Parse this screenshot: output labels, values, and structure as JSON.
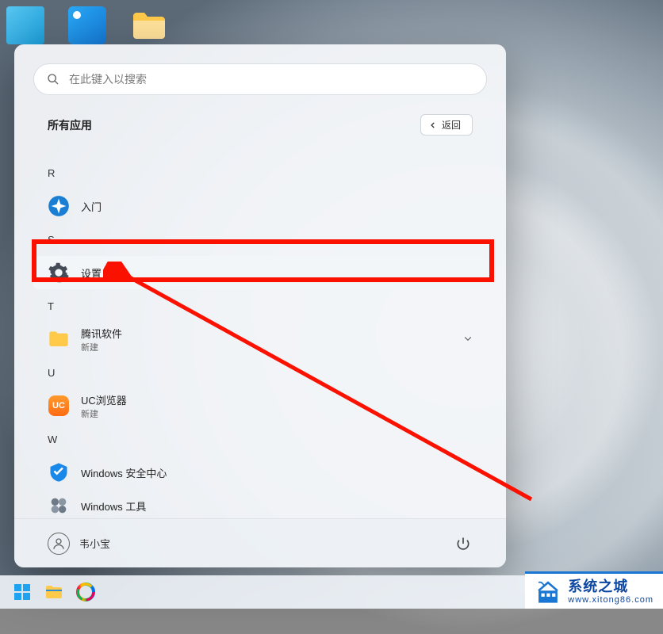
{
  "search": {
    "placeholder": "在此键入以搜索"
  },
  "header": {
    "title": "所有应用",
    "back_label": "返回"
  },
  "sections": {
    "partial_item": {
      "label": "新建"
    },
    "R": "R",
    "r_items": [
      {
        "label": "入门"
      }
    ],
    "S": "S",
    "s_items": [
      {
        "label": "设置"
      }
    ],
    "T": "T",
    "t_items": [
      {
        "label": "腾讯软件",
        "sublabel": "新建",
        "has_children": true
      }
    ],
    "U": "U",
    "u_items": [
      {
        "label": "UC浏览器",
        "sublabel": "新建"
      }
    ],
    "W": "W",
    "w_items": [
      {
        "label": "Windows 安全中心"
      },
      {
        "label": "Windows 工具"
      }
    ]
  },
  "footer": {
    "user_name": "韦小宝"
  },
  "watermark": {
    "title": "系统之城",
    "url": "www.xitong86.com"
  }
}
